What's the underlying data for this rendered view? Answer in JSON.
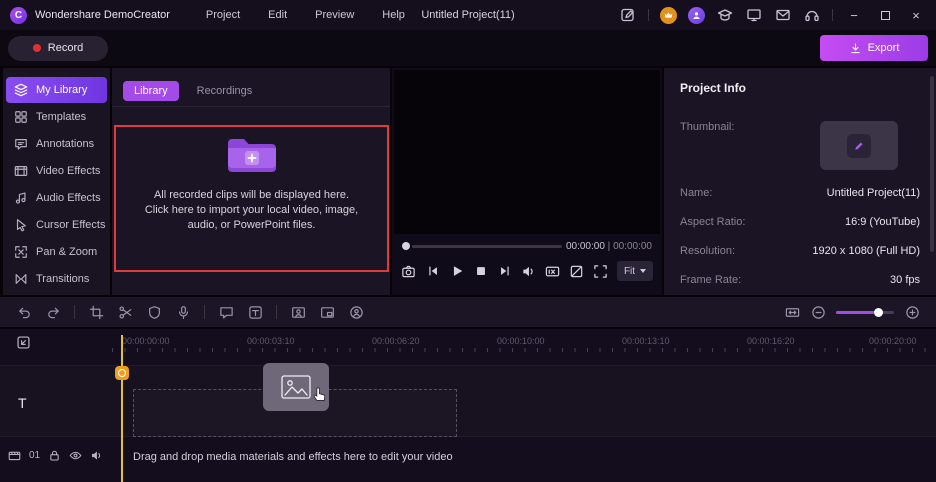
{
  "colors": {
    "accent_purple": "#9b4de8",
    "export_gradient_start": "#c44df2",
    "export_gradient_end": "#9c3ce6",
    "record_red": "#e03131",
    "import_box_border": "#e03a3a",
    "playhead_yellow": "#e2c23a",
    "playhead_badge_orange": "#ef9f1e",
    "panel_bg": "#1a1424"
  },
  "titlebar": {
    "app_name": "Wondershare DemoCreator",
    "menus": [
      "Project",
      "Edit",
      "Preview",
      "Help"
    ],
    "project_title": "Untitled Project(11)",
    "window": {
      "minimize": "−",
      "close": "×"
    }
  },
  "actionbar": {
    "record": "Record",
    "export": "Export"
  },
  "sidebar": [
    "My Library",
    "Templates",
    "Annotations",
    "Video Effects",
    "Audio Effects",
    "Cursor Effects",
    "Pan & Zoom",
    "Transitions"
  ],
  "library": {
    "tab_library": "Library",
    "tab_recordings": "Recordings",
    "empty_line1": "All recorded clips will be displayed here.",
    "empty_line2": "Click here to import your local video, image, audio, or PowerPoint files."
  },
  "preview": {
    "time_current": "00:00:00",
    "time_separator": "|",
    "time_total": "00:00:00",
    "fit": "Fit"
  },
  "project_info": {
    "title": "Project Info",
    "thumbnail_label": "Thumbnail:",
    "name_label": "Name:",
    "name_value": "Untitled Project(11)",
    "aspect_label": "Aspect Ratio:",
    "aspect_value": "16:9 (YouTube)",
    "resolution_label": "Resolution:",
    "resolution_value": "1920 x 1080 (Full HD)",
    "framerate_label": "Frame Rate:",
    "framerate_value": "30 fps"
  },
  "timeline": {
    "ruler": [
      "00:00:00:00",
      "00:00:03:10",
      "00:00:06:20",
      "00:00:10:00",
      "00:00:13:10",
      "00:00:16:20",
      "00:00:20:00"
    ],
    "text_track_label": "T",
    "video_track_number": "01",
    "drop_hint": "Drag and drop media materials and effects here to edit your video"
  }
}
